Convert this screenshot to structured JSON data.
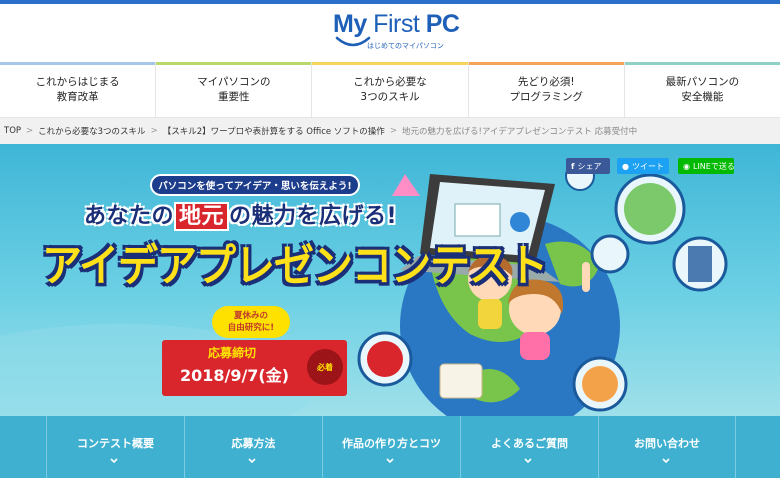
{
  "header": {
    "logo_main_a": "My",
    "logo_main_b": " First ",
    "logo_main_c": "PC",
    "logo_sub": "はじめてのマイパソコン"
  },
  "global_nav": [
    {
      "label": "これからはじまる\n教育改革",
      "color": "#a5c8e8"
    },
    {
      "label": "マイパソコンの\n重要性",
      "color": "#b8d86b"
    },
    {
      "label": "これから必要な\n3つのスキル",
      "color": "#f4d45a"
    },
    {
      "label": "先どり必須!\nプログラミング",
      "color": "#f4a45a"
    },
    {
      "label": "最新パソコンの\n安全機能",
      "color": "#8fd1c4"
    }
  ],
  "breadcrumb": {
    "items": [
      "TOP",
      "これから必要な3つのスキル",
      "【スキル2】ワープロや表計算をする Office ソフトの操作"
    ],
    "current": "地元の魅力を広げる!アイデアプレゼンコンテスト 応募受付中"
  },
  "share": {
    "facebook": "シェア",
    "twitter": "ツイート",
    "line": "LINEで送る"
  },
  "hero": {
    "pill": "パソコンを使ってアイデア・思いを伝えよう!",
    "tagline_a": "あなたの",
    "tagline_hl": "地元",
    "tagline_b": "の魅力を広げる!",
    "headline": "アイデアプレゼンコンテスト",
    "bubble": "夏休みの\n自由研究に!",
    "deadline_label": "応募締切",
    "deadline_date": "2018/9/7(金)",
    "deadline_badge": "必着"
  },
  "sub_nav": [
    "コンテスト概要",
    "応募方法",
    "作品の作り方とコツ",
    "よくあるご質問",
    "お問い合わせ"
  ],
  "colors": {
    "brand": "#1e5fb8",
    "hero_sky": "#3fb6d7",
    "subnav": "#3fb0cf",
    "deadline": "#d9262c",
    "headline": "#ffe11a"
  }
}
